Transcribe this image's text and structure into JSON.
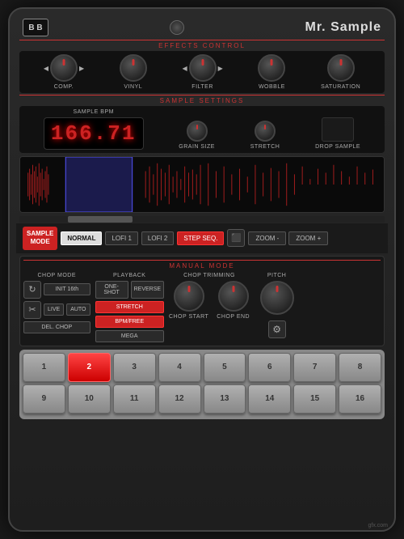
{
  "header": {
    "logo": "B B",
    "title": "Mr. Sample"
  },
  "effects_control": {
    "label": "EFFECTS CONTROL",
    "knobs": [
      {
        "id": "comp",
        "label": "COMP.",
        "has_arrows": true
      },
      {
        "id": "vinyl",
        "label": "VINYL",
        "has_arrows": false
      },
      {
        "id": "filter",
        "label": "FILTER",
        "has_arrows": true
      },
      {
        "id": "wobble",
        "label": "WOBBLE",
        "has_arrows": false
      },
      {
        "id": "saturation",
        "label": "SATURATION",
        "has_arrows": false
      }
    ]
  },
  "sample_settings": {
    "label": "SAMPLE SETTINGS",
    "bpm_label": "SAMPLE BPM",
    "bpm_value": "166.71",
    "grain_label": "GRAIN SIZE",
    "stretch_label": "STRETCH",
    "drop_label": "DROP SAMPLE"
  },
  "mode_buttons": {
    "sample_mode_line1": "SAMPLE",
    "sample_mode_line2": "MODE",
    "buttons": [
      "NORMAL",
      "LOFI 1",
      "LOFI 2",
      "STEP SEQ."
    ],
    "active_index": 0,
    "zoom_minus": "ZOOM -",
    "zoom_plus": "ZOOM +"
  },
  "manual_mode": {
    "label": "MANUAL MODE",
    "chop_mode": {
      "label": "CHOP MODE",
      "buttons": [
        {
          "label": "INIT 16th"
        },
        {
          "label": "LIVE"
        },
        {
          "label": "AUTO"
        },
        {
          "label": "DEL. CHOP"
        }
      ]
    },
    "playback": {
      "label": "PLAYBACK",
      "buttons": [
        {
          "label": "ONE-SHOT",
          "style": "normal"
        },
        {
          "label": "REVERSE",
          "style": "normal"
        },
        {
          "label": "STRETCH",
          "style": "red"
        },
        {
          "label": "BPM/FREE",
          "style": "red"
        },
        {
          "label": "MEGA",
          "style": "normal"
        }
      ]
    },
    "trimming": {
      "label": "CHOP TRIMMING",
      "start_label": "CHOP START",
      "end_label": "CHOP END"
    },
    "pitch": {
      "label": "PITCH"
    }
  },
  "pads": {
    "row1": [
      "1",
      "2",
      "3",
      "4",
      "5",
      "6",
      "7",
      "8"
    ],
    "row2": [
      "9",
      "10",
      "11",
      "12",
      "13",
      "14",
      "15",
      "16"
    ],
    "active_pad": "2"
  },
  "watermark": "gfx.com"
}
